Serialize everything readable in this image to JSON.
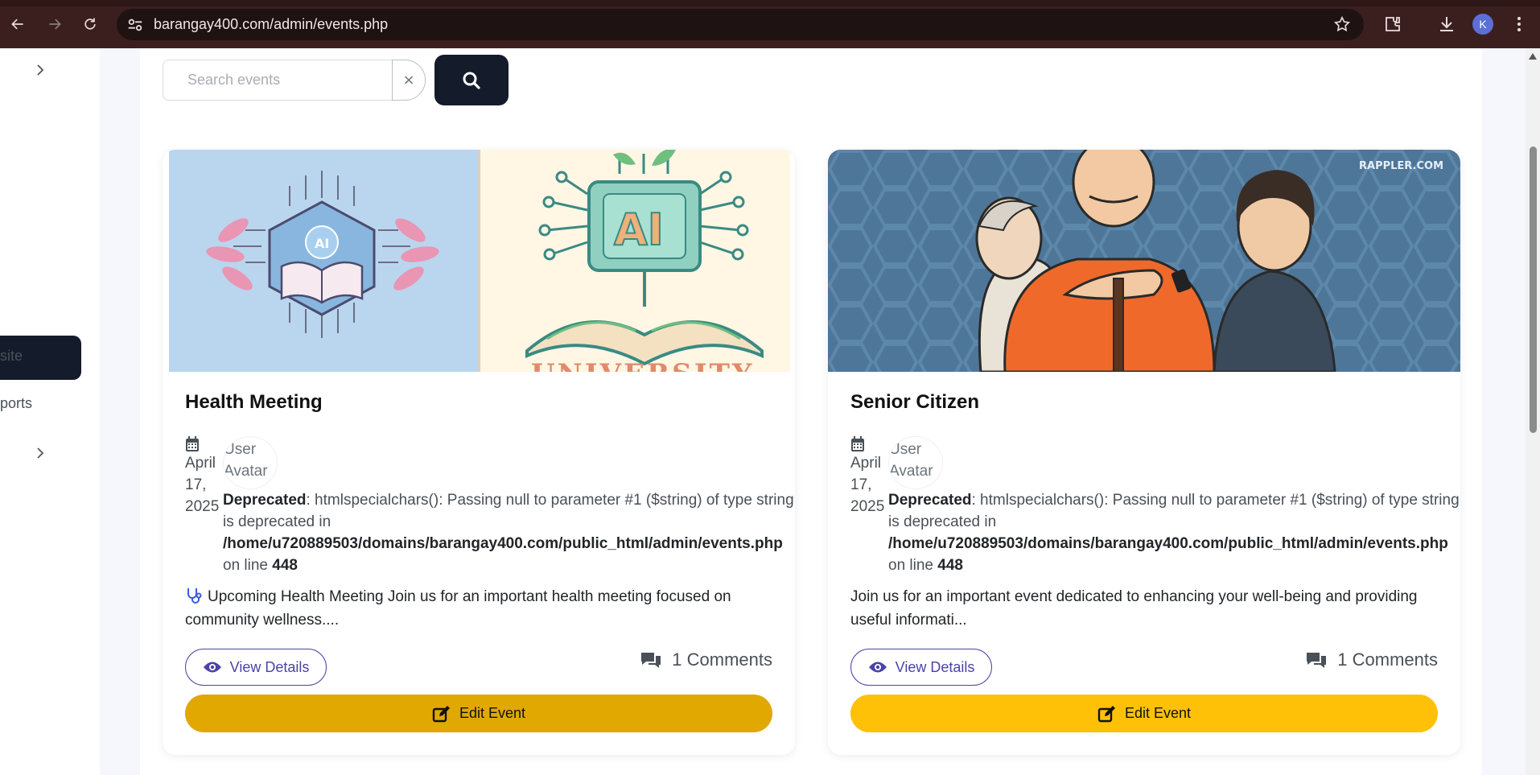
{
  "browser": {
    "url": "barangay400.com/admin/events.php",
    "profile_initial": "K"
  },
  "sidebar": {
    "items": [
      {
        "label": "site"
      },
      {
        "label": "ports"
      }
    ]
  },
  "search": {
    "placeholder": "Search events",
    "clear_symbol": "×"
  },
  "events": [
    {
      "title": "Health Meeting",
      "date": "April 17, 2025",
      "avatar_alt": "User Avatar",
      "warning": {
        "label": "Deprecated",
        "message": ": htmlspecialchars(): Passing null to parameter #1 ($string) of type string is deprecated in",
        "path": "/home/u720889503/domains/barangay400.com/public_html/admin/events.php",
        "line_prefix": "on line",
        "line": "448"
      },
      "description": "Upcoming Health Meeting Join us for an important health meeting focused on community wellness....",
      "description_icon": "stethoscope-icon",
      "view_label": "View Details",
      "comments": "1 Comments",
      "edit_label": "Edit Event",
      "edit_color": "#e0a800",
      "image_text": "UNIVERSITY"
    },
    {
      "title": "Senior Citizen",
      "date": "April 17, 2025",
      "avatar_alt": "User Avatar",
      "warning": {
        "label": "Deprecated",
        "message": ": htmlspecialchars(): Passing null to parameter #1 ($string) of type string is deprecated in",
        "path": "/home/u720889503/domains/barangay400.com/public_html/admin/events.php",
        "line_prefix": "on line",
        "line": "448"
      },
      "description": "Join us for an important event dedicated to enhancing your well-being and providing useful informati...",
      "view_label": "View Details",
      "comments": "1 Comments",
      "edit_label": "Edit Event",
      "edit_color": "#ffc107",
      "image_text": "RAPPLER.COM"
    }
  ],
  "colors": {
    "primary_dark": "#141c2c",
    "view_outline": "#4b43a6"
  }
}
